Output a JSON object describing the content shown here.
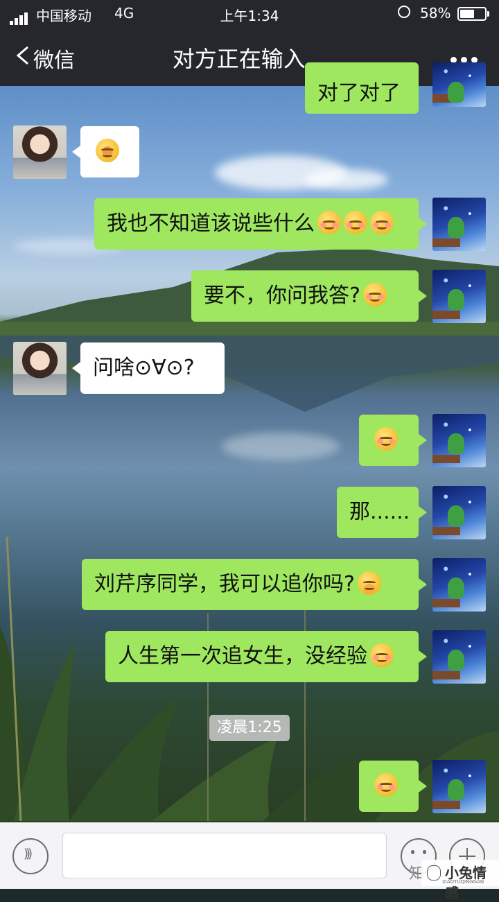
{
  "status_bar": {
    "carrier": "中国移动",
    "network": "4G",
    "time": "上午1:34",
    "battery_percent": "58%",
    "battery_level": 0.58
  },
  "nav": {
    "back_label": "微信",
    "title": "对方正在输入..."
  },
  "messages": [
    {
      "side": "in",
      "text": "",
      "emoji": "face-cry-laugh"
    },
    {
      "side": "out",
      "text": "我也不知道该说些什么",
      "emoji": "face-blush x3"
    },
    {
      "side": "out",
      "text": "要不，你问我答?",
      "emoji": "face-blush"
    },
    {
      "side": "in",
      "text": "问啥⊙∀⊙?"
    },
    {
      "side": "out",
      "text": "",
      "emoji": "face-blush"
    },
    {
      "side": "out",
      "text": "那......"
    },
    {
      "side": "out",
      "text": "刘芹序同学，我可以追你吗?",
      "emoji": "face-cover-mouth"
    },
    {
      "side": "out",
      "text": "人生第一次追女生，没经验",
      "emoji": "face-blush"
    },
    {
      "side": "out",
      "text": "",
      "emoji": "face-blush"
    }
  ],
  "partial_top_text": "对了对了",
  "timestamp": "凌晨1:25",
  "watermark": {
    "prefix": "知",
    "brand_cn": "小兔情感",
    "brand_en": "XIAOTUQINGGAN"
  },
  "colors": {
    "nav_bg": "#25272d",
    "bubble_out": "#9ee75f",
    "bubble_in": "#ffffff"
  }
}
